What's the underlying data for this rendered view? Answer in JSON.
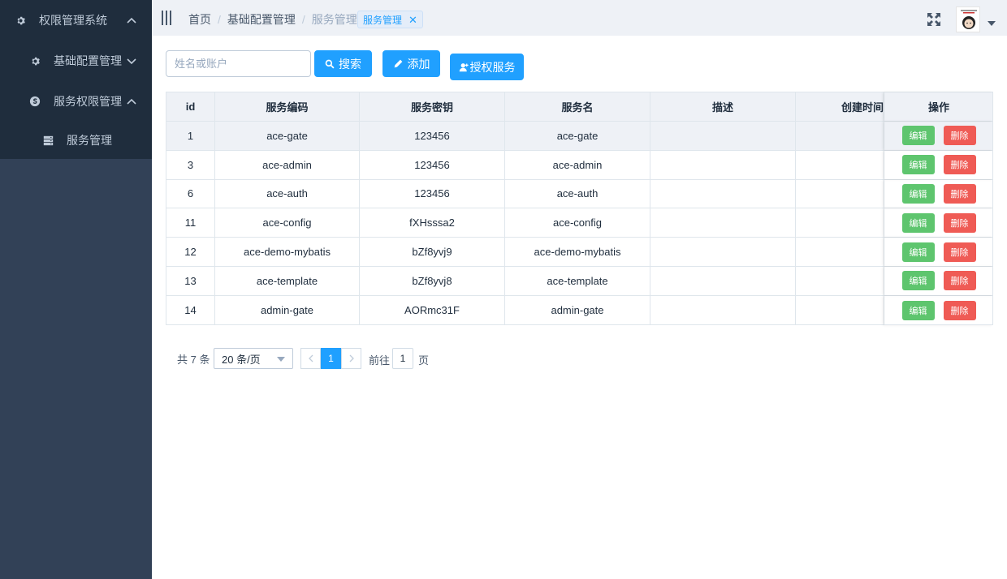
{
  "sidebar": {
    "title": "权限管理系统",
    "groups": [
      {
        "label": "基础配置管理",
        "expanded": false
      },
      {
        "label": "服务权限管理",
        "expanded": true,
        "items": [
          {
            "label": "服务管理"
          }
        ]
      }
    ]
  },
  "header": {
    "breadcrumb": [
      "首页",
      "基础配置管理",
      "服务管理"
    ],
    "tab": {
      "label": "服务管理"
    }
  },
  "toolbar": {
    "search_placeholder": "姓名或账户",
    "search_value": "",
    "search_label": "搜索",
    "add_label": "添加",
    "auth_label": "授权服务"
  },
  "table": {
    "columns": [
      "id",
      "服务编码",
      "服务密钥",
      "服务名",
      "描述",
      "创建时间",
      "操作"
    ],
    "edit_label": "编辑",
    "delete_label": "删除",
    "rows": [
      {
        "id": "1",
        "code": "ace-gate",
        "secret": "123456",
        "name": "ace-gate",
        "desc": "",
        "time": ""
      },
      {
        "id": "3",
        "code": "ace-admin",
        "secret": "123456",
        "name": "ace-admin",
        "desc": "",
        "time": ""
      },
      {
        "id": "6",
        "code": "ace-auth",
        "secret": "123456",
        "name": "ace-auth",
        "desc": "",
        "time": ""
      },
      {
        "id": "11",
        "code": "ace-config",
        "secret": "fXHsssa2",
        "name": "ace-config",
        "desc": "",
        "time": ""
      },
      {
        "id": "12",
        "code": "ace-demo-mybatis",
        "secret": "bZf8yvj9",
        "name": "ace-demo-mybatis",
        "desc": "",
        "time": ""
      },
      {
        "id": "13",
        "code": "ace-template",
        "secret": "bZf8yvj8",
        "name": "ace-template",
        "desc": "",
        "time": ""
      },
      {
        "id": "14",
        "code": "admin-gate",
        "secret": "AORmc31F",
        "name": "admin-gate",
        "desc": "",
        "time": ""
      }
    ]
  },
  "pagination": {
    "total_label": "共 7 条",
    "page_size": "20 条/页",
    "current_page": "1",
    "goto_prefix": "前往",
    "goto_value": "1",
    "goto_suffix": "页"
  },
  "colors": {
    "sidebar_bg": "#324157",
    "sidebar_dark": "#1f2d3d",
    "primary": "#20a0ff",
    "success": "#5ec56e",
    "danger": "#ef5b55"
  }
}
